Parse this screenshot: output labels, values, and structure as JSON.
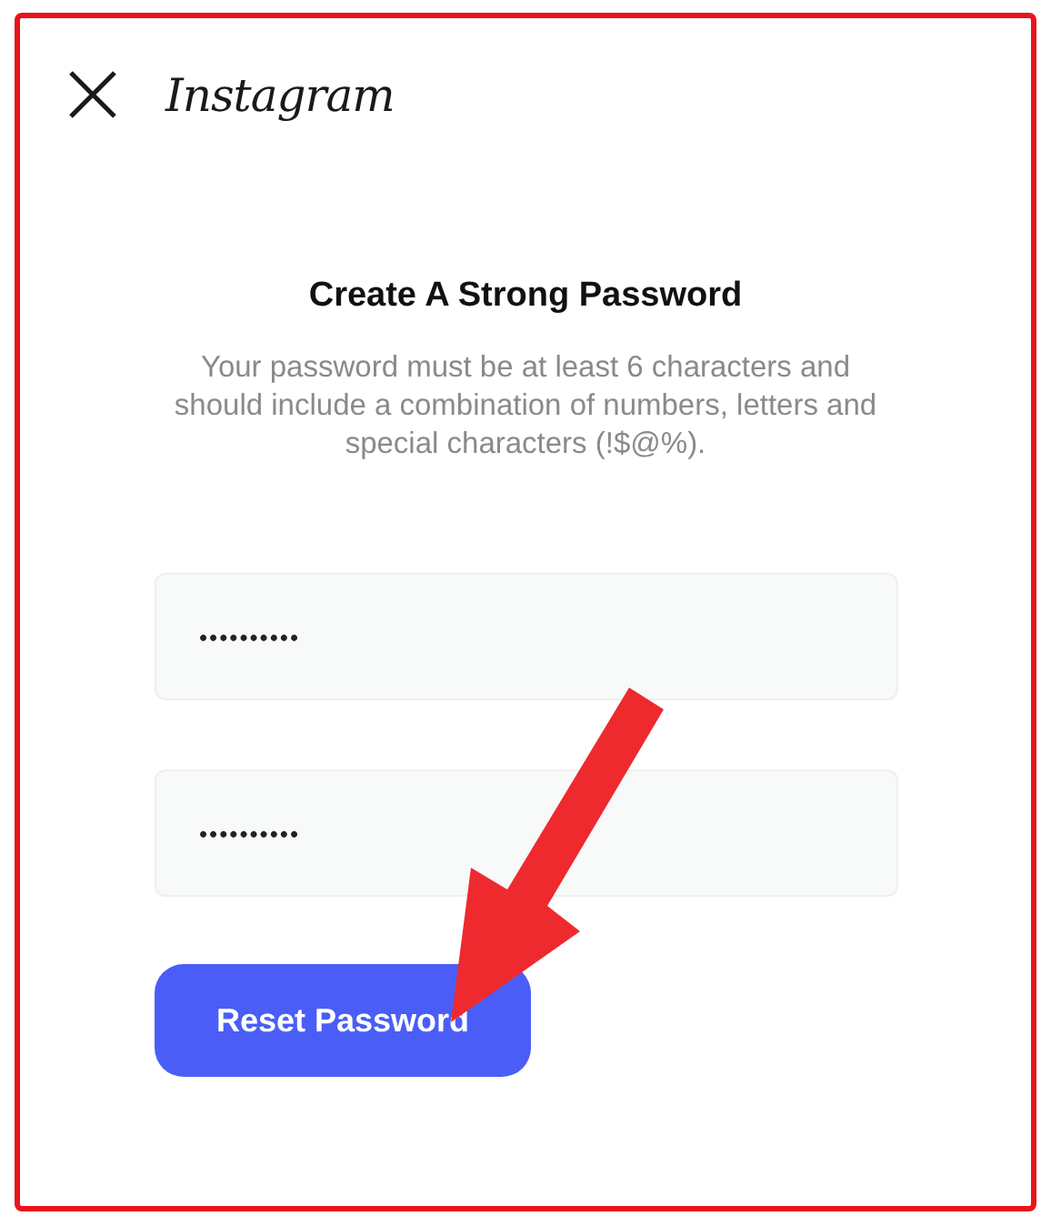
{
  "header": {
    "brand": "Instagram"
  },
  "title": "Create A Strong Password",
  "description": "Your password must be at least 6 characters and should include a combination of numbers, letters and special characters (!$@%).",
  "fields": [
    {
      "value": "••••••••••"
    },
    {
      "value": "••••••••••"
    }
  ],
  "button": "Reset Password"
}
